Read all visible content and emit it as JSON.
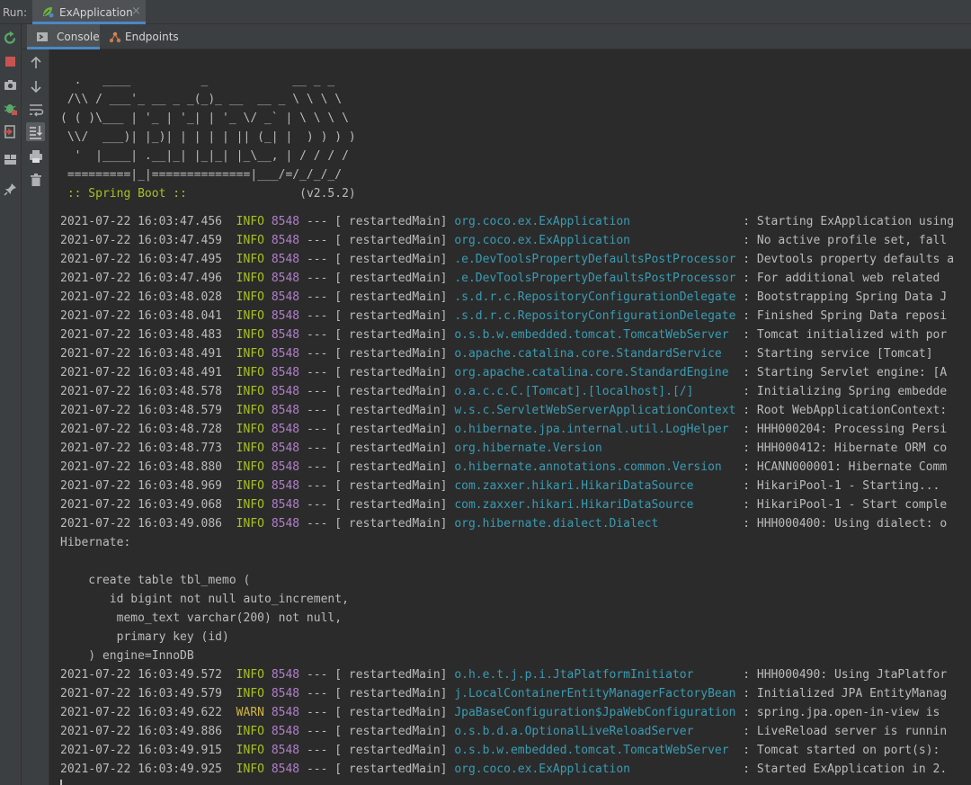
{
  "run_bar": {
    "label": "Run:",
    "tab_title": "ExApplication",
    "close_glyph": "×"
  },
  "left_toolbar": [
    {
      "name": "rerun-icon",
      "color": "#59a869"
    },
    {
      "name": "stop-icon",
      "color": "#c75450"
    },
    {
      "name": "camera-icon",
      "color": "#afb1b3"
    },
    {
      "name": "debug-icon",
      "color": "#59a869"
    },
    {
      "name": "exit-icon",
      "color": "#c75450"
    },
    {
      "name": "layout-icon",
      "color": "#afb1b3"
    },
    {
      "name": "pin-icon",
      "color": "#afb1b3"
    }
  ],
  "sub_tabs": [
    {
      "label": "Console",
      "icon": "console-icon",
      "active": true
    },
    {
      "label": "Endpoints",
      "icon": "endpoints-icon",
      "active": false
    }
  ],
  "side_toolbar": [
    {
      "name": "up-arrow-icon"
    },
    {
      "name": "down-arrow-icon"
    },
    {
      "name": "soft-wrap-icon"
    },
    {
      "name": "scroll-to-end-icon"
    },
    {
      "name": "print-icon"
    },
    {
      "name": "trash-icon"
    }
  ],
  "banner": {
    "lines": [
      "  .   ____          _            __ _ _",
      " /\\\\ / ___'_ __ _ _(_)_ __  __ _ \\ \\ \\ \\",
      "( ( )\\___ | '_ | '_| | '_ \\/ _` | \\ \\ \\ \\",
      " \\\\/  ___)| |_)| | | | | || (_| |  ) ) ) )",
      "  '  |____| .__|_| |_|_| |_\\__, | / / / /",
      " =========|_|==============|___/=/_/_/_/"
    ],
    "spring_label": " :: Spring Boot :: ",
    "version": "               (v2.5.2)"
  },
  "log_lines": [
    {
      "type": "log",
      "date": "2021-07-22 16:03:47.456",
      "level": "INFO",
      "pid": "8548",
      "thread": " restartedMain",
      "logger": "org.coco.ex.ExApplication               ",
      "message": "Starting ExApplication using"
    },
    {
      "type": "log",
      "date": "2021-07-22 16:03:47.459",
      "level": "INFO",
      "pid": "8548",
      "thread": " restartedMain",
      "logger": "org.coco.ex.ExApplication               ",
      "message": "No active profile set, fall"
    },
    {
      "type": "log",
      "date": "2021-07-22 16:03:47.495",
      "level": "INFO",
      "pid": "8548",
      "thread": " restartedMain",
      "logger": ".e.DevToolsPropertyDefaultsPostProcessor",
      "message": "Devtools property defaults a"
    },
    {
      "type": "log",
      "date": "2021-07-22 16:03:47.496",
      "level": "INFO",
      "pid": "8548",
      "thread": " restartedMain",
      "logger": ".e.DevToolsPropertyDefaultsPostProcessor",
      "message": "For additional web related"
    },
    {
      "type": "log",
      "date": "2021-07-22 16:03:48.028",
      "level": "INFO",
      "pid": "8548",
      "thread": " restartedMain",
      "logger": ".s.d.r.c.RepositoryConfigurationDelegate",
      "message": "Bootstrapping Spring Data J"
    },
    {
      "type": "log",
      "date": "2021-07-22 16:03:48.041",
      "level": "INFO",
      "pid": "8548",
      "thread": " restartedMain",
      "logger": ".s.d.r.c.RepositoryConfigurationDelegate",
      "message": "Finished Spring Data reposi"
    },
    {
      "type": "log",
      "date": "2021-07-22 16:03:48.483",
      "level": "INFO",
      "pid": "8548",
      "thread": " restartedMain",
      "logger": "o.s.b.w.embedded.tomcat.TomcatWebServer ",
      "message": "Tomcat initialized with por"
    },
    {
      "type": "log",
      "date": "2021-07-22 16:03:48.491",
      "level": "INFO",
      "pid": "8548",
      "thread": " restartedMain",
      "logger": "o.apache.catalina.core.StandardService  ",
      "message": "Starting service [Tomcat]"
    },
    {
      "type": "log",
      "date": "2021-07-22 16:03:48.491",
      "level": "INFO",
      "pid": "8548",
      "thread": " restartedMain",
      "logger": "org.apache.catalina.core.StandardEngine ",
      "message": "Starting Servlet engine: [A"
    },
    {
      "type": "log",
      "date": "2021-07-22 16:03:48.578",
      "level": "INFO",
      "pid": "8548",
      "thread": " restartedMain",
      "logger": "o.a.c.c.C.[Tomcat].[localhost].[/]      ",
      "message": "Initializing Spring embedde"
    },
    {
      "type": "log",
      "date": "2021-07-22 16:03:48.579",
      "level": "INFO",
      "pid": "8548",
      "thread": " restartedMain",
      "logger": "w.s.c.ServletWebServerApplicationContext",
      "message": "Root WebApplicationContext:"
    },
    {
      "type": "log",
      "date": "2021-07-22 16:03:48.728",
      "level": "INFO",
      "pid": "8548",
      "thread": " restartedMain",
      "logger": "o.hibernate.jpa.internal.util.LogHelper ",
      "message": "HHH000204: Processing Persi"
    },
    {
      "type": "log",
      "date": "2021-07-22 16:03:48.773",
      "level": "INFO",
      "pid": "8548",
      "thread": " restartedMain",
      "logger": "org.hibernate.Version                   ",
      "message": "HHH000412: Hibernate ORM co"
    },
    {
      "type": "log",
      "date": "2021-07-22 16:03:48.880",
      "level": "INFO",
      "pid": "8548",
      "thread": " restartedMain",
      "logger": "o.hibernate.annotations.common.Version  ",
      "message": "HCANN000001: Hibernate Comm"
    },
    {
      "type": "log",
      "date": "2021-07-22 16:03:48.969",
      "level": "INFO",
      "pid": "8548",
      "thread": " restartedMain",
      "logger": "com.zaxxer.hikari.HikariDataSource      ",
      "message": "HikariPool-1 - Starting..."
    },
    {
      "type": "log",
      "date": "2021-07-22 16:03:49.068",
      "level": "INFO",
      "pid": "8548",
      "thread": " restartedMain",
      "logger": "com.zaxxer.hikari.HikariDataSource      ",
      "message": "HikariPool-1 - Start comple"
    },
    {
      "type": "log",
      "date": "2021-07-22 16:03:49.086",
      "level": "INFO",
      "pid": "8548",
      "thread": " restartedMain",
      "logger": "org.hibernate.dialect.Dialect           ",
      "message": "HHH000400: Using dialect: o"
    },
    {
      "type": "plain",
      "text": "Hibernate: "
    },
    {
      "type": "plain",
      "text": ""
    },
    {
      "type": "plain",
      "text": "    create table tbl_memo ("
    },
    {
      "type": "plain",
      "text": "       id bigint not null auto_increment,"
    },
    {
      "type": "plain",
      "text": "        memo_text varchar(200) not null,"
    },
    {
      "type": "plain",
      "text": "        primary key (id)"
    },
    {
      "type": "plain",
      "text": "    ) engine=InnoDB"
    },
    {
      "type": "log",
      "date": "2021-07-22 16:03:49.572",
      "level": "INFO",
      "pid": "8548",
      "thread": " restartedMain",
      "logger": "o.h.e.t.j.p.i.JtaPlatformInitiator      ",
      "message": "HHH000490: Using JtaPlatfor"
    },
    {
      "type": "log",
      "date": "2021-07-22 16:03:49.579",
      "level": "INFO",
      "pid": "8548",
      "thread": " restartedMain",
      "logger": "j.LocalContainerEntityManagerFactoryBean",
      "message": "Initialized JPA EntityManag"
    },
    {
      "type": "log",
      "date": "2021-07-22 16:03:49.622",
      "level": "WARN",
      "pid": "8548",
      "thread": " restartedMain",
      "logger": "JpaBaseConfiguration$JpaWebConfiguration",
      "message": "spring.jpa.open-in-view is"
    },
    {
      "type": "log",
      "date": "2021-07-22 16:03:49.886",
      "level": "INFO",
      "pid": "8548",
      "thread": " restartedMain",
      "logger": "o.s.b.d.a.OptionalLiveReloadServer      ",
      "message": "LiveReload server is runnin"
    },
    {
      "type": "log",
      "date": "2021-07-22 16:03:49.915",
      "level": "INFO",
      "pid": "8548",
      "thread": " restartedMain",
      "logger": "o.s.b.w.embedded.tomcat.TomcatWebServer ",
      "message": "Tomcat started on port(s):"
    },
    {
      "type": "log",
      "date": "2021-07-22 16:03:49.925",
      "level": "INFO",
      "pid": "8548",
      "thread": " restartedMain",
      "logger": "org.coco.ex.ExApplication               ",
      "message": "Started ExApplication in 2."
    }
  ],
  "colors": {
    "info": "#a8c023",
    "warn": "#d0b344",
    "pid": "#b07fc9",
    "logger": "#3a9bb2",
    "text": "#bbbbbb",
    "background": "#2b2b2b",
    "accent": "#4a88c7"
  }
}
